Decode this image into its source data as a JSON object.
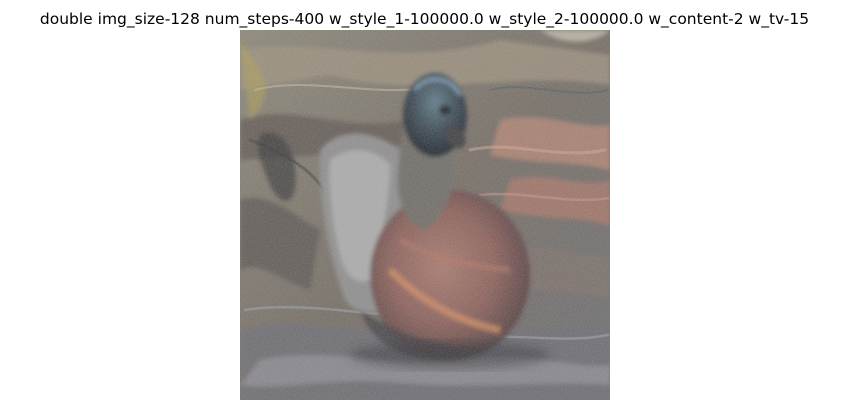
{
  "figure": {
    "title": "double img_size-128 num_steps-400 w_style_1-100000.0 w_style_2-100000.0 w_content-2 w_tv-15"
  },
  "image": {
    "subject": "duck",
    "dominant_colors": [
      "#7f7868",
      "#6b5d56",
      "#9b6f63",
      "#475b68",
      "#c5c0b2"
    ]
  }
}
